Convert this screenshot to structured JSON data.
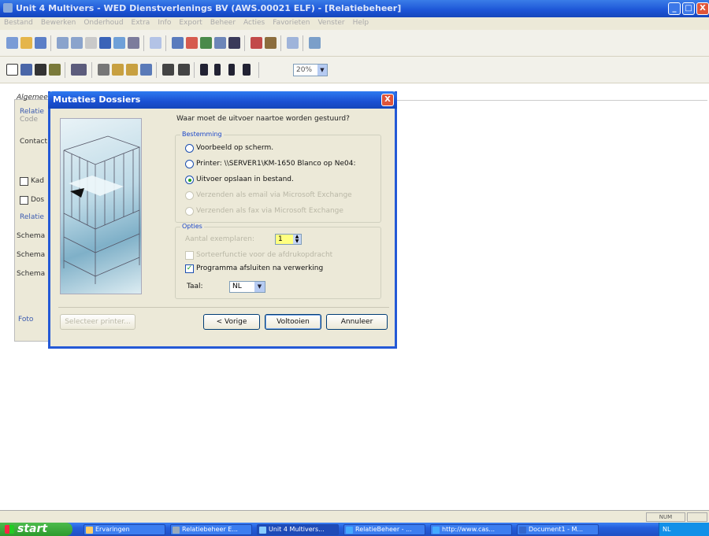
{
  "window": {
    "title": "Unit 4 Multivers - WED Dienstverlenings BV (AWS.00021 ELF) - [Relatiebeheer]",
    "minimize": "_",
    "maximize": "□",
    "close": "X"
  },
  "menu": [
    "Bestand",
    "Bewerken",
    "Onderhoud",
    "Extra",
    "Info",
    "Export",
    "Beheer",
    "Acties",
    "Favorieten",
    "Venster",
    "Help"
  ],
  "toolbar": {
    "zoom": "20%"
  },
  "background_form": {
    "labels": [
      "Algemeen",
      "Relatie",
      "Code",
      "Contact",
      "Kad",
      "Dos",
      "Relatie",
      "Schema",
      "Schema",
      "Schema",
      "Foto"
    ]
  },
  "dialog": {
    "title": "Mutaties Dossiers",
    "close": "X",
    "question": "Waar moet de uitvoer naartoe worden gestuurd?",
    "bestemming": {
      "label": "Bestemming",
      "options": [
        {
          "label": "Voorbeeld op scherm.",
          "checked": false,
          "disabled": false
        },
        {
          "label": "Printer: \\\\SERVER1\\KM-1650 Blanco op Ne04:",
          "checked": false,
          "disabled": false
        },
        {
          "label": "Uitvoer opslaan in bestand.",
          "checked": true,
          "disabled": false
        },
        {
          "label": "Verzenden als email via Microsoft Exchange",
          "checked": false,
          "disabled": true
        },
        {
          "label": "Verzenden als fax via Microsoft Exchange",
          "checked": false,
          "disabled": true
        }
      ]
    },
    "opties": {
      "label": "Opties",
      "copies_label": "Aantal exemplaren:",
      "copies_value": "1",
      "checkbox1": {
        "label": "Sorteerfunctie voor de afdrukopdracht",
        "checked": false,
        "disabled": true
      },
      "checkbox2": {
        "label": "Programma afsluiten na verwerking",
        "checked": true,
        "disabled": false
      },
      "taal_label": "Taal:",
      "taal_value": "NL"
    },
    "buttons": {
      "printer": "Selecteer printer...",
      "back": "< Vorige",
      "finish": "Voltooien",
      "cancel": "Annuleer"
    }
  },
  "statusbar": {
    "num": "NUM"
  },
  "taskbar": {
    "start": "start",
    "tasks": [
      {
        "label": "Ervaringen",
        "active": false
      },
      {
        "label": "Relatiebeheer E...",
        "active": false
      },
      {
        "label": "Unit 4 Multivers...",
        "active": true
      },
      {
        "label": "RelatieBeheer - ...",
        "active": false
      },
      {
        "label": "http://www.cas...",
        "active": false
      },
      {
        "label": "Document1 - M...",
        "active": false
      }
    ],
    "tray": "NL"
  },
  "colors": {
    "titlebar": "#1c54d6",
    "dialog_bg": "#ece9d8",
    "taskbar": "#245edb",
    "start": "#2e9a2e"
  }
}
